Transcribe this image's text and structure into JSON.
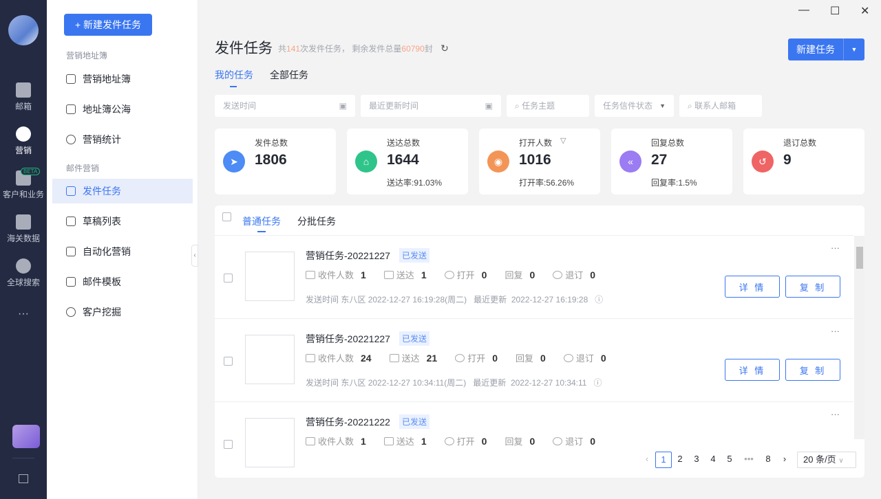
{
  "rail": {
    "items": [
      {
        "label": "邮箱"
      },
      {
        "label": "营销"
      },
      {
        "label": "客户和业务",
        "badge": "BETA"
      },
      {
        "label": "海关数据"
      },
      {
        "label": "全球搜索"
      }
    ],
    "more": "···"
  },
  "sidebar": {
    "new_button": "+ 新建发件任务",
    "group1": "营销地址簿",
    "group1_items": [
      "营销地址簿",
      "地址簿公海",
      "营销统计"
    ],
    "group2": "邮件营销",
    "group2_items": [
      "发件任务",
      "草稿列表",
      "自动化营销",
      "邮件模板",
      "客户挖掘"
    ]
  },
  "window": {
    "minimize": "—",
    "maximize": "☐",
    "close": "✕"
  },
  "header": {
    "title": "发件任务",
    "summary_pre": "共",
    "task_count": "141",
    "summary_mid": "次发件任务， 剩余发件总量",
    "remaining": "60790",
    "summary_post": "封",
    "new_task": "新建任务",
    "tabs": [
      "我的任务",
      "全部任务"
    ]
  },
  "filters": {
    "send_time": "发送时间",
    "update_time": "最近更新时间",
    "subject": "任务主题",
    "status": "任务信件状态",
    "contact": "联系人邮箱"
  },
  "stats": [
    {
      "label": "发件总数",
      "value": "1806",
      "rate": "",
      "color": "#4d8bf5"
    },
    {
      "label": "送达总数",
      "value": "1644",
      "rate": "送达率:91.03%",
      "color": "#2fc48a"
    },
    {
      "label": "打开人数",
      "value": "1016",
      "rate": "打开率:56.26%",
      "color": "#f39556"
    },
    {
      "label": "回复总数",
      "value": "27",
      "rate": "回复率:1.5%",
      "color": "#9b7cf2"
    },
    {
      "label": "退订总数",
      "value": "9",
      "rate": "",
      "color": "#ef6464"
    }
  ],
  "list": {
    "tabs": [
      "普通任务",
      "分批任务"
    ],
    "labels": {
      "recipients": "收件人数",
      "delivered": "送达",
      "opened": "打开",
      "replied": "回复",
      "unsub": "退订",
      "send_time": "发送时间",
      "updated": "最近更新",
      "detail": "详 情",
      "copy": "复 制"
    },
    "rows": [
      {
        "title": "营销任务-20221227",
        "status": "已发送",
        "recipients": "1",
        "delivered": "1",
        "opened": "0",
        "replied": "0",
        "unsub": "0",
        "send_time": "东八区 2022-12-27 16:19:28(周二)",
        "updated": "2022-12-27 16:19:28"
      },
      {
        "title": "营销任务-20221227",
        "status": "已发送",
        "recipients": "24",
        "delivered": "21",
        "opened": "0",
        "replied": "0",
        "unsub": "0",
        "send_time": "东八区 2022-12-27 10:34:11(周二)",
        "updated": "2022-12-27 10:34:11"
      },
      {
        "title": "营销任务-20221222",
        "status": "已发送",
        "recipients": "1",
        "delivered": "1",
        "opened": "0",
        "replied": "0",
        "unsub": "0",
        "send_time": "",
        "updated": ""
      }
    ]
  },
  "pagination": {
    "pages": [
      "1",
      "2",
      "3",
      "4",
      "5",
      "•••",
      "8"
    ],
    "current": "1",
    "page_size": "20 条/页"
  }
}
